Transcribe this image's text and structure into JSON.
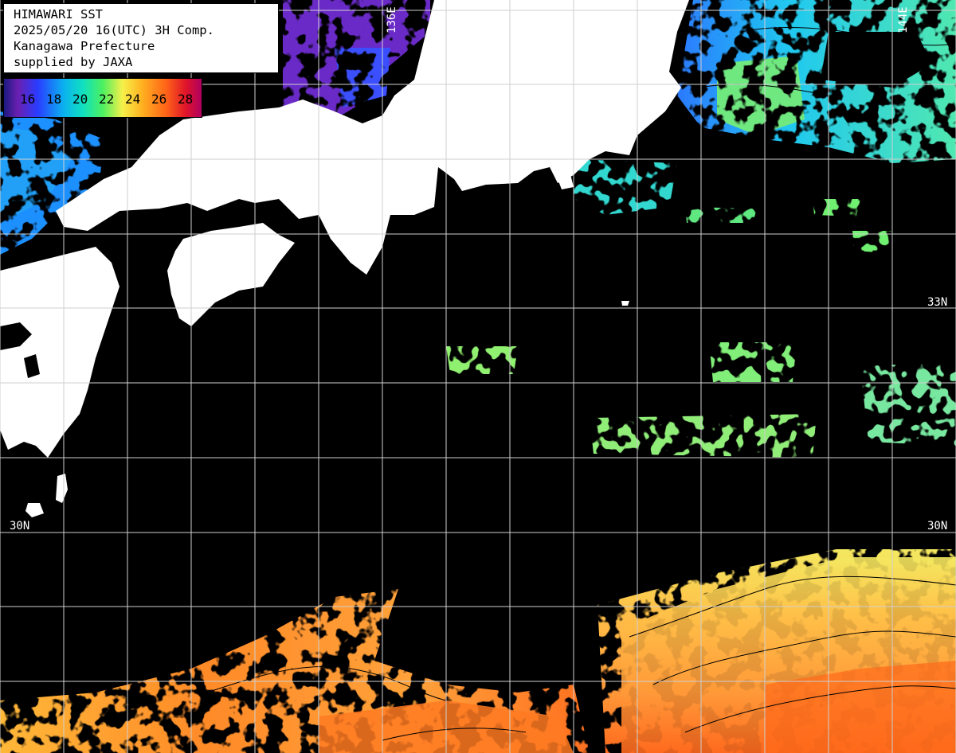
{
  "header": {
    "title": "HIMAWARI SST",
    "datetime": "2025/05/20 16(UTC) 3H Comp.",
    "region": "Kanagawa Prefecture",
    "credit": "supplied by JAXA"
  },
  "color_scale": {
    "unit_values": [
      "16",
      "18",
      "20",
      "22",
      "24",
      "26",
      "28"
    ]
  },
  "grid_labels": {
    "lat_33_left": "33",
    "lat_33_right": "33N",
    "lat_30_left": "30N",
    "lat_30_right": "30N",
    "lon_136": "136E",
    "lon_144": "144E"
  },
  "colors": {
    "land": "#ffffff",
    "no_data": "#000000",
    "grid": "#cfcfcf",
    "contour": "#000000"
  }
}
